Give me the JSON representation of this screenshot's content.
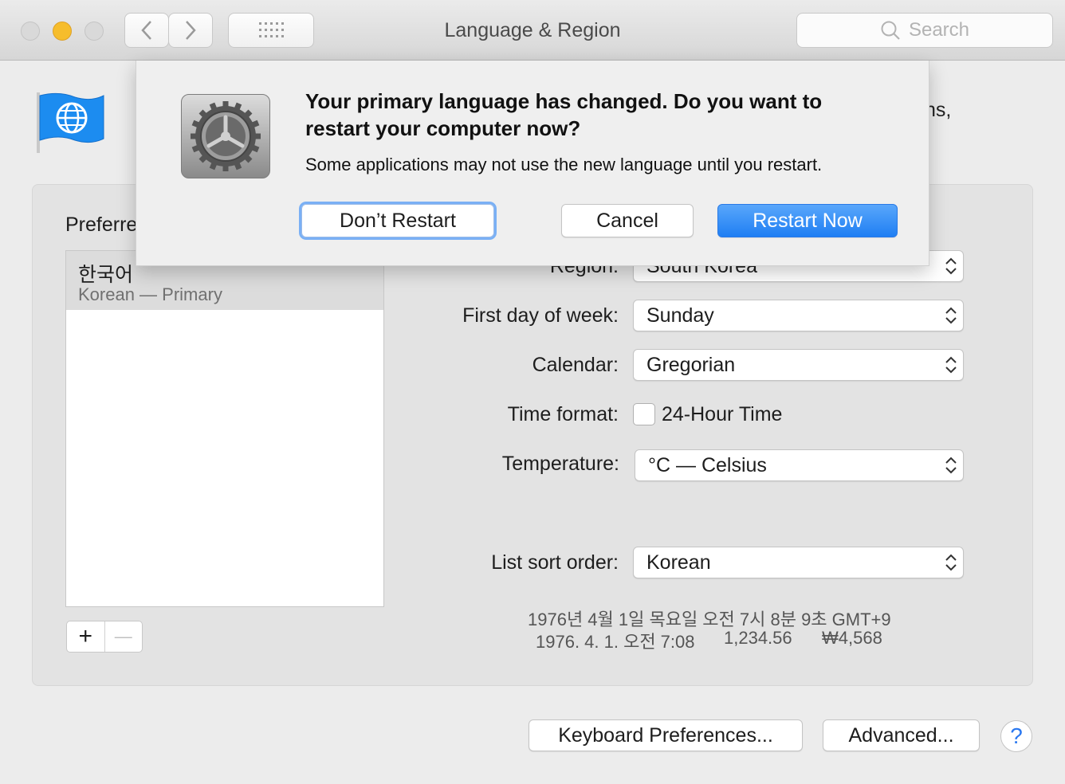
{
  "window": {
    "title": "Language & Region",
    "search_placeholder": "Search"
  },
  "header": {
    "partial_text": "ɲs,"
  },
  "preferred_languages": {
    "label": "Preferre",
    "items": [
      {
        "name": "한국어",
        "sub": "Korean — Primary"
      }
    ],
    "add_label": "+",
    "remove_label": "—"
  },
  "settings": {
    "region_label": "Region:",
    "region_value": "South Korea",
    "first_day_label": "First day of week:",
    "first_day_value": "Sunday",
    "calendar_label": "Calendar:",
    "calendar_value": "Gregorian",
    "time_format_label": "Time format:",
    "time_format_checkbox": "24-Hour Time",
    "temperature_label": "Temperature:",
    "temperature_value": "°C — Celsius",
    "sort_label": "List sort order:",
    "sort_value": "Korean"
  },
  "sample": {
    "line1": "1976년 4월 1일 목요일 오전 7시 8분 9초 GMT+9",
    "date_short": "1976. 4. 1. 오전 7:08",
    "number": "1,234.56",
    "currency": "₩4,568"
  },
  "footer": {
    "keyboard_button": "Keyboard Preferences...",
    "advanced_button": "Advanced...",
    "help_label": "?"
  },
  "dialog": {
    "title": "Your primary language has changed. Do you want to restart your computer now?",
    "message": "Some applications may not use the new language until you restart.",
    "dont_restart": "Don’t Restart",
    "cancel": "Cancel",
    "restart_now": "Restart Now"
  },
  "colors": {
    "accent": "#1f7ff3",
    "close": "#d8d8d8",
    "minimize": "#f6bd2c"
  }
}
